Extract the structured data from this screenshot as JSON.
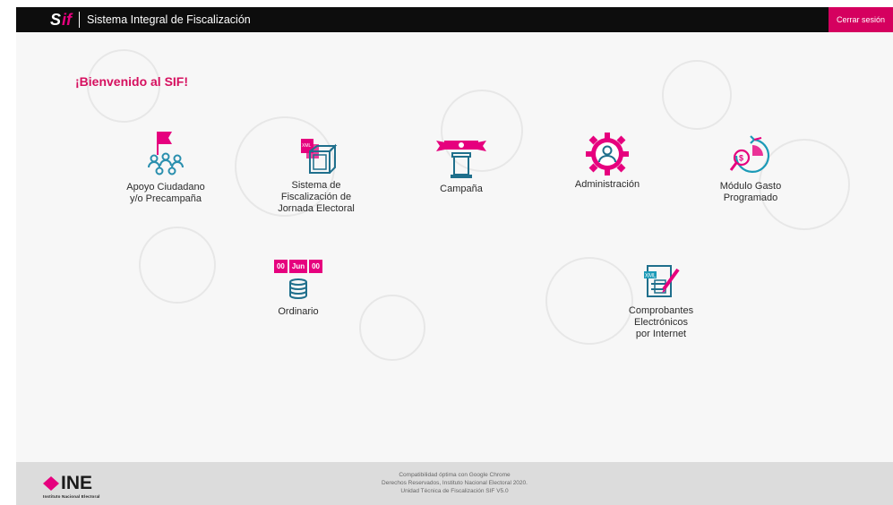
{
  "header": {
    "logo_s": "S",
    "logo_if": "if",
    "title": "Sistema Integral de Fiscalización",
    "logout_label": "Cerrar sesión"
  },
  "main": {
    "welcome": "¡Bienvenido al SIF!",
    "modules": [
      {
        "label_lines": [
          "Apoyo Ciudadano",
          "y/o Precampaña"
        ],
        "icon": "flag-people-icon"
      },
      {
        "label_lines": [
          "Sistema de",
          "Fiscalización de",
          "Jornada Electoral"
        ],
        "icon": "ballot-box-icon"
      },
      {
        "label_lines": [
          "Campaña"
        ],
        "icon": "podium-icon"
      },
      {
        "label_lines": [
          "Administración"
        ],
        "icon": "admin-gear-icon"
      },
      {
        "label_lines": [
          "Módulo Gasto",
          "Programado"
        ],
        "icon": "money-clock-icon"
      },
      {
        "label_lines": [
          "Ordinario"
        ],
        "icon": "coins-calendar-icon",
        "calendar": [
          "00",
          "Jun",
          "00"
        ]
      },
      {
        "label_lines": [
          "Comprobantes",
          "Electrónicos",
          "por Internet"
        ],
        "icon": "xml-document-icon",
        "badge": "XML"
      }
    ]
  },
  "footer": {
    "logo_text": "INE",
    "logo_sub": "Instituto Nacional Electoral",
    "lines": [
      "Compatibilidad óptima con Google Chrome",
      "Derechos Reservados, Instituto Nacional Electoral 2020.",
      "Unidad Técnica de Fiscalización SIF V5.0"
    ]
  },
  "colors": {
    "accent": "#e6007e",
    "accent_dark": "#d5005f",
    "teal": "#1b9ab7",
    "header_bg": "#0d0d0d",
    "footer_bg": "#dcdcdc"
  }
}
